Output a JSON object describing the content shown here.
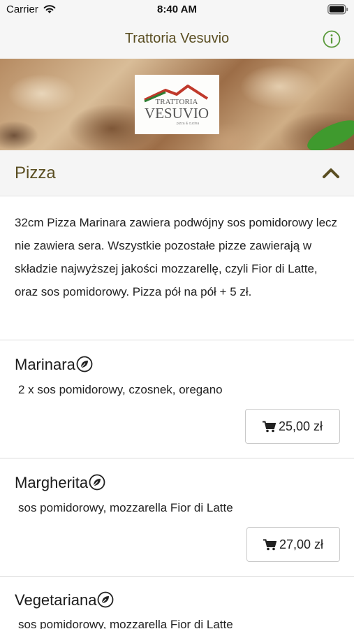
{
  "status_bar": {
    "carrier": "Carrier",
    "time": "8:40 AM"
  },
  "nav": {
    "title": "Trattoria Vesuvio",
    "info_icon": "info-icon"
  },
  "hero": {
    "logo": {
      "line1": "TRATTORIA",
      "line2": "VESUVIO",
      "tagline": "pizza & cucina"
    }
  },
  "section": {
    "title": "Pizza",
    "description": "32cm Pizza Marinara zawiera podwójny sos pomidorowy lecz nie zawiera sera. Wszystkie pozostałe pizze zawierają w składzie najwyższej jakości mozzarellę, czyli Fior di Latte, oraz sos pomidorowy. Pizza pół na pół + 5 zł."
  },
  "menu_items": [
    {
      "name": "Marinara",
      "description": "2 x sos pomidorowy, czosnek, oregano",
      "price": "25,00 zł",
      "icon": "leaf-icon"
    },
    {
      "name": "Margherita",
      "description": "sos pomidorowy, mozzarella Fior di Latte",
      "price": "27,00 zł",
      "icon": "leaf-icon"
    },
    {
      "name": "Vegetariana",
      "description": "sos pomidorowy, mozzarella Fior di Latte",
      "icon": "leaf-icon"
    }
  ],
  "colors": {
    "accent_green": "#5b9a3c",
    "title_brown": "#5a4e22",
    "logo_red": "#c0392b"
  }
}
